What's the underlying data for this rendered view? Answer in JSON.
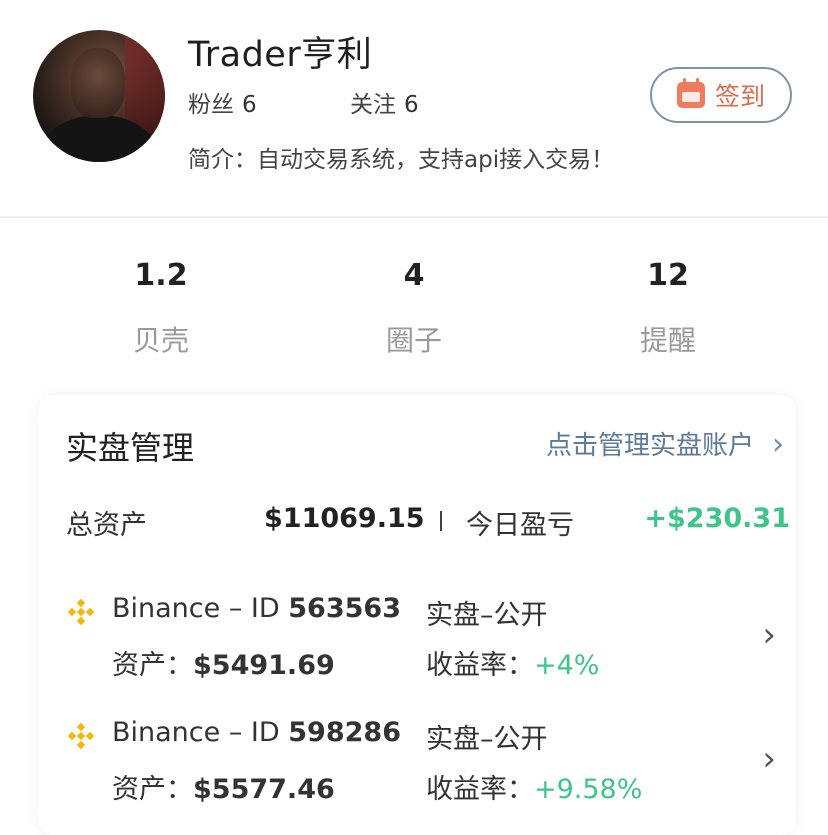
{
  "profile": {
    "username": "Trader亨利",
    "followers_label": "粉丝",
    "followers_count": "6",
    "following_label": "关注",
    "following_count": "6",
    "bio": "简介：自动交易系统，支持api接入交易！",
    "checkin_label": "签到"
  },
  "counters": [
    {
      "value": "1.2",
      "label": "贝壳"
    },
    {
      "value": "4",
      "label": "圈子"
    },
    {
      "value": "12",
      "label": "提醒"
    }
  ],
  "live": {
    "title": "实盘管理",
    "manage_link": "点击管理实盘账户",
    "total_label": "总资产",
    "total_value": "$11069.15",
    "today_label": "今日盈亏",
    "today_value": "+$230.31",
    "accounts": [
      {
        "exchange": "Binance – ID ",
        "id": "563563",
        "type": "实盘–公开",
        "asset_label": "资产：",
        "asset_value": "$5491.69",
        "yield_label": "收益率：",
        "yield_value": "+4%"
      },
      {
        "exchange": "Binance – ID ",
        "id": "598286",
        "type": "实盘–公开",
        "asset_label": "资产：",
        "asset_value": "$5577.46",
        "yield_label": "收益率：",
        "yield_value": "+9.58%"
      }
    ]
  },
  "colors": {
    "accent_green": "#3fc48a",
    "link_blue": "#5c7a9a",
    "checkin_orange": "#e06a4e",
    "binance_gold": "#f0b90b"
  }
}
